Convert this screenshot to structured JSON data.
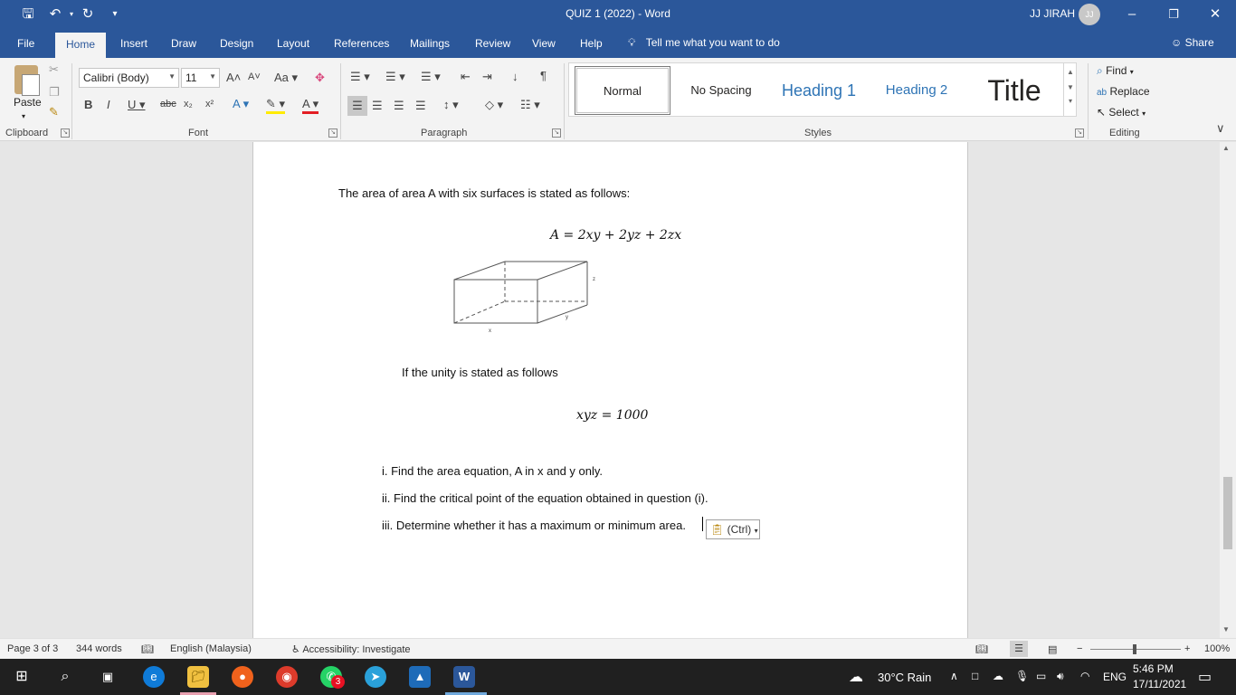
{
  "titlebar": {
    "title": "QUIZ 1 (2022)  -  Word",
    "user": "JJ JIRAH",
    "avatar_initials": "JJ"
  },
  "tabs": [
    "File",
    "Home",
    "Insert",
    "Draw",
    "Design",
    "Layout",
    "References",
    "Mailings",
    "Review",
    "View",
    "Help"
  ],
  "active_tab": "Home",
  "tell_me": "Tell me what you want to do",
  "share": "Share",
  "ribbon": {
    "paste": "Paste",
    "font_name": "Calibri (Body)",
    "font_size": "11",
    "groups": [
      "Clipboard",
      "Font",
      "Paragraph",
      "Styles",
      "Editing"
    ],
    "styles": [
      "Normal",
      "No Spacing",
      "Heading 1",
      "Heading 2",
      "Title"
    ],
    "editing": [
      "Find",
      "Replace",
      "Select"
    ]
  },
  "document": {
    "intro": "The area of area A with six surfaces is stated as follows:",
    "equation1": "A = 2xy + 2yz + 2zx",
    "box_labels": {
      "x": "x",
      "y": "y",
      "z": "z"
    },
    "unity_text": "If the unity is stated as follows",
    "equation2": "xyz = 1000",
    "questions": [
      "i. Find the area equation, A in x and y only.",
      "ii. Find the critical point of the equation obtained in question (i).",
      "iii. Determine whether it has a maximum or minimum area."
    ],
    "paste_options": "(Ctrl)"
  },
  "status": {
    "page": "Page 3 of 3",
    "words": "344 words",
    "language": "English (Malaysia)",
    "accessibility": "Accessibility: Investigate",
    "zoom": "100%"
  },
  "taskbar": {
    "whatsapp_badge": "3",
    "weather": "30°C  Rain",
    "lang": "ENG",
    "time": "5:46 PM",
    "date": "17/11/2021"
  },
  "colors": {
    "word_blue": "#2b579a",
    "heading_blue": "#2e74b5"
  }
}
